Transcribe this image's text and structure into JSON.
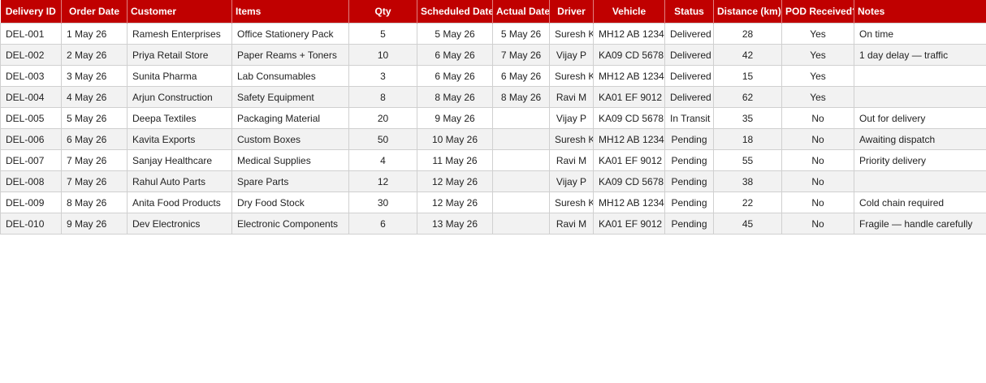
{
  "columns": [
    "Delivery ID",
    "Order Date",
    "Customer",
    "Items",
    "Qty",
    "Scheduled Date",
    "Actual Date",
    "Driver",
    "Vehicle",
    "Status",
    "Distance (km)",
    "POD Received?",
    "Notes"
  ],
  "rows": [
    [
      "DEL-001",
      "1 May 26",
      "Ramesh Enterprises",
      "Office Stationery Pack",
      "5",
      "5 May 26",
      "5 May 26",
      "Suresh K",
      "MH12 AB 1234",
      "Delivered",
      "28",
      "Yes",
      "On time"
    ],
    [
      "DEL-002",
      "2 May 26",
      "Priya Retail Store",
      "Paper Reams + Toners",
      "10",
      "6 May 26",
      "7 May 26",
      "Vijay P",
      "KA09 CD 5678",
      "Delivered",
      "42",
      "Yes",
      "1 day delay — traffic"
    ],
    [
      "DEL-003",
      "3 May 26",
      "Sunita Pharma",
      "Lab Consumables",
      "3",
      "6 May 26",
      "6 May 26",
      "Suresh K",
      "MH12 AB 1234",
      "Delivered",
      "15",
      "Yes",
      ""
    ],
    [
      "DEL-004",
      "4 May 26",
      "Arjun Construction",
      "Safety Equipment",
      "8",
      "8 May 26",
      "8 May 26",
      "Ravi M",
      "KA01 EF 9012",
      "Delivered",
      "62",
      "Yes",
      ""
    ],
    [
      "DEL-005",
      "5 May 26",
      "Deepa Textiles",
      "Packaging Material",
      "20",
      "9 May 26",
      "",
      "Vijay P",
      "KA09 CD 5678",
      "In Transit",
      "35",
      "No",
      "Out for delivery"
    ],
    [
      "DEL-006",
      "6 May 26",
      "Kavita Exports",
      "Custom Boxes",
      "50",
      "10 May 26",
      "",
      "Suresh K",
      "MH12 AB 1234",
      "Pending",
      "18",
      "No",
      "Awaiting dispatch"
    ],
    [
      "DEL-007",
      "7 May 26",
      "Sanjay Healthcare",
      "Medical Supplies",
      "4",
      "11 May 26",
      "",
      "Ravi M",
      "KA01 EF 9012",
      "Pending",
      "55",
      "No",
      "Priority delivery"
    ],
    [
      "DEL-008",
      "7 May 26",
      "Rahul Auto Parts",
      "Spare Parts",
      "12",
      "12 May 26",
      "",
      "Vijay P",
      "KA09 CD 5678",
      "Pending",
      "38",
      "No",
      ""
    ],
    [
      "DEL-009",
      "8 May 26",
      "Anita Food Products",
      "Dry Food Stock",
      "30",
      "12 May 26",
      "",
      "Suresh K",
      "MH12 AB 1234",
      "Pending",
      "22",
      "No",
      "Cold chain required"
    ],
    [
      "DEL-010",
      "9 May 26",
      "Dev Electronics",
      "Electronic Components",
      "6",
      "13 May 26",
      "",
      "Ravi M",
      "KA01 EF 9012",
      "Pending",
      "45",
      "No",
      "Fragile — handle carefully"
    ]
  ],
  "colors": {
    "header_bg": "#c00000",
    "header_text": "#ffffff",
    "stripe_bg": "#f2f2f2",
    "grid_line": "#d0d0d0"
  }
}
